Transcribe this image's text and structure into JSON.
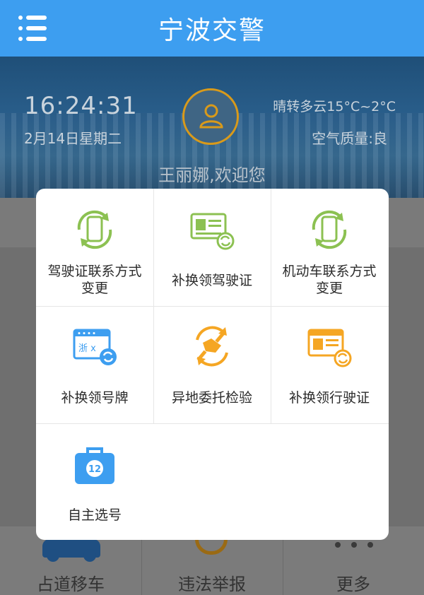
{
  "app": {
    "title": "宁波交警"
  },
  "icons": {
    "menu": "menu-icon"
  },
  "hero": {
    "time": "16:24:31",
    "date": "2月14日星期二",
    "weather": "晴转多云15°C~2°C",
    "air": "空气质量:良",
    "welcome": "王丽娜,欢迎您"
  },
  "bottom_nav": [
    {
      "label": "占道移车",
      "icon": "car-icon"
    },
    {
      "label": "违法举报",
      "icon": "report-icon"
    },
    {
      "label": "更多",
      "icon": "more-icon"
    }
  ],
  "menu_items": [
    {
      "line1": "驾驶证联系方式",
      "line2": "变更",
      "icon": "phone-sync-icon",
      "color": "#8cc152"
    },
    {
      "line1": "补换领驾驶证",
      "line2": "",
      "icon": "id-card-sync-icon",
      "color": "#8cc152"
    },
    {
      "line1": "机动车联系方式",
      "line2": "变更",
      "icon": "phone-sync-icon",
      "color": "#8cc152"
    },
    {
      "line1": "补换领号牌",
      "line2": "",
      "icon": "license-plate-icon",
      "color": "#3d9ef0"
    },
    {
      "line1": "异地委托检验",
      "line2": "",
      "icon": "handshake-tools-icon",
      "color": "#f5a623"
    },
    {
      "line1": "补换领行驶证",
      "line2": "",
      "icon": "vehicle-license-icon",
      "color": "#f5a623"
    },
    {
      "line1": "自主选号",
      "line2": "",
      "icon": "number-pick-icon",
      "color": "#3d9ef0"
    }
  ],
  "plate_text": "浙 x",
  "pick_number": "12",
  "colors": {
    "primary": "#3d9ef0",
    "green": "#8cc152",
    "orange": "#f5a623"
  }
}
